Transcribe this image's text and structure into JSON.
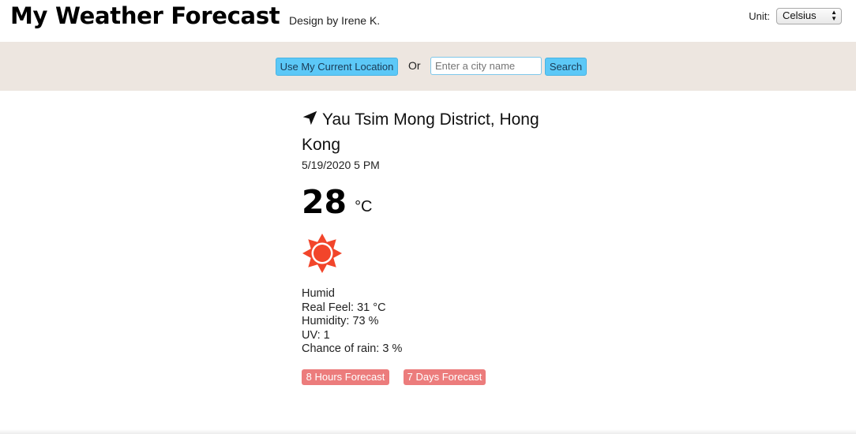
{
  "header": {
    "title": "My Weather Forecast",
    "byline": "Design by Irene K.",
    "unit_label": "Unit:",
    "unit_selected": "Celsius"
  },
  "search": {
    "location_button": "Use My Current Location",
    "or_text": "Or",
    "placeholder": "Enter a city name",
    "search_button": "Search"
  },
  "weather": {
    "location": "Yau Tsim Mong District, Hong Kong",
    "datetime": "5/19/2020 5 PM",
    "temperature": "28",
    "temperature_unit": "°C",
    "icon": "sun-icon",
    "condition": "Humid",
    "real_feel": "Real Feel: 31 °C",
    "humidity": "Humidity: 73 %",
    "uv": "UV: 1",
    "rain": "Chance of rain: 3 %"
  },
  "forecast": {
    "hours_button": "8 Hours Forecast",
    "days_button": "7 Days Forecast"
  },
  "colors": {
    "accent_blue": "#5cc8f7",
    "accent_red": "#ec7c7c",
    "search_bar_bg": "#ede6e0",
    "sun_color": "#f2452a"
  }
}
